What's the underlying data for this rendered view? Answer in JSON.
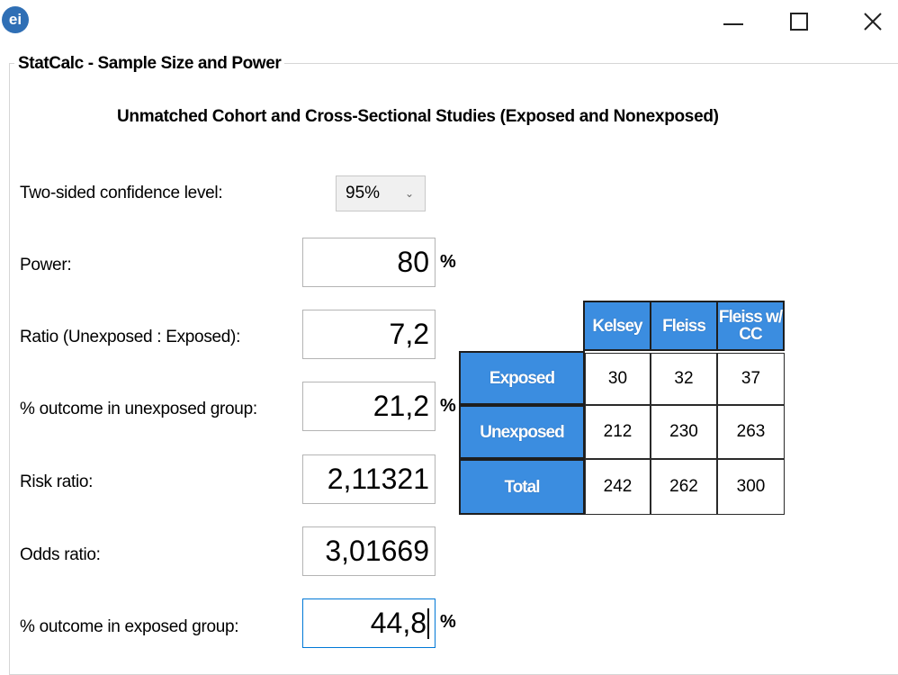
{
  "window": {
    "logo_text": "ei",
    "buttons": [
      "minimize",
      "maximize",
      "close"
    ]
  },
  "group": {
    "title": "StatCalc - Sample Size and Power",
    "subtitle": "Unmatched Cohort and Cross-Sectional Studies (Exposed and Nonexposed)"
  },
  "form": {
    "confidence": {
      "label": "Two-sided confidence level:",
      "value": "95%"
    },
    "power": {
      "label": "Power:",
      "value": "80",
      "unit": "%"
    },
    "ratio": {
      "label": "Ratio (Unexposed : Exposed):",
      "value": "7,2"
    },
    "unexposed_outcome": {
      "label": "% outcome in unexposed group:",
      "value": "21,2",
      "unit": "%"
    },
    "risk_ratio": {
      "label": "Risk ratio:",
      "value": "2,11321"
    },
    "odds_ratio": {
      "label": "Odds ratio:",
      "value": "3,01669"
    },
    "exposed_outcome": {
      "label": "% outcome in exposed group:",
      "value": "44,8",
      "unit": "%"
    }
  },
  "results": {
    "columns": [
      "Kelsey",
      "Fleiss",
      "Fleiss w/ CC"
    ],
    "rows": [
      {
        "label": "Exposed",
        "values": [
          "30",
          "32",
          "37"
        ]
      },
      {
        "label": "Unexposed",
        "values": [
          "212",
          "230",
          "263"
        ]
      },
      {
        "label": "Total",
        "values": [
          "242",
          "262",
          "300"
        ]
      }
    ]
  },
  "colors": {
    "header_bg": "#3b8de0",
    "focus_border": "#0078d7"
  }
}
